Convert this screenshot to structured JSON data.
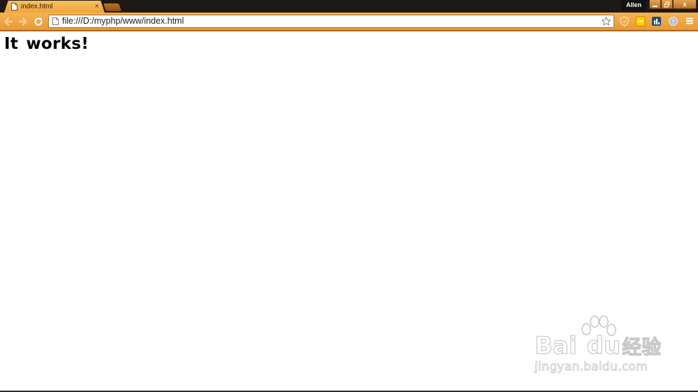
{
  "browser": {
    "tab": {
      "title": "index.html",
      "close_glyph": "×"
    },
    "profile_name": "Allen",
    "window_buttons": {
      "close_glyph": "x"
    },
    "address_bar": {
      "url": "file:///D:/myphp/www/index.html"
    },
    "extensions": [
      "shield-extension-icon",
      "yellow-extension-icon",
      "chart-extension-icon",
      "grey-circle-extension-icon"
    ],
    "accent_color": "#f1a43a"
  },
  "page": {
    "heading": "It works!"
  },
  "watermark": {
    "brand_prefix": "Bai",
    "brand_suffix": "du",
    "brand_chinese": "经验",
    "url": "jingyan.baidu.com"
  }
}
